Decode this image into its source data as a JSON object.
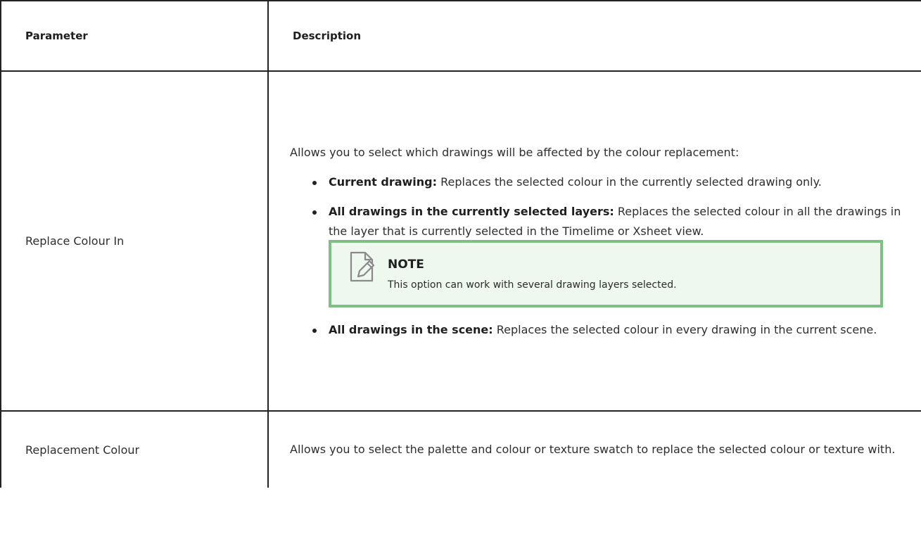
{
  "header": {
    "col1": "Parameter",
    "col2": "Description"
  },
  "rows": [
    {
      "parameter": "Replace Colour In",
      "intro": "Allows you to select which drawings will be affected by the colour replacement:",
      "options": [
        {
          "label": "Current drawing:",
          "text": " Replaces the selected colour in the currently selected drawing only."
        },
        {
          "label": "All drawings in the currently selected layers:",
          "text": " Replaces the selected colour in all the drawings in the layer that is currently selected in the Timelime or Xsheet view."
        },
        {
          "label": "All drawings in the scene:",
          "text": " Replaces the selected colour in every drawing in the current scene."
        }
      ],
      "note": {
        "icon": "note-pencil-icon",
        "title": "NOTE",
        "text": "This option can work with several drawing layers selected."
      }
    },
    {
      "parameter": "Replacement Colour",
      "description": "Allows you to select the palette and colour or texture swatch to replace the selected colour or texture with."
    }
  ],
  "colors": {
    "border": "#222222",
    "note_border": "#7fbf84",
    "note_background": "#eef8ee",
    "icon_stroke": "#8a8a8a"
  }
}
